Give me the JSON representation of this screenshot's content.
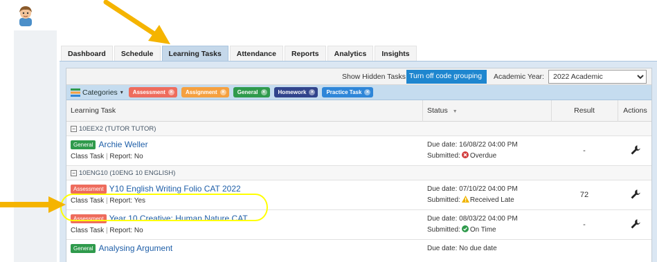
{
  "tabs": [
    "Dashboard",
    "Schedule",
    "Learning Tasks",
    "Attendance",
    "Reports",
    "Analytics",
    "Insights"
  ],
  "active_tab": "Learning Tasks",
  "toolbar": {
    "show_hidden_label": "Show Hidden Tasks",
    "code_grouping_button": "Turn off code grouping",
    "academic_year_label": "Academic Year:",
    "academic_year_value": "2022 Academic"
  },
  "categories": {
    "label": "Categories",
    "caret": "▾",
    "chips": [
      {
        "label": "Assessment",
        "color": "#ee6c5d"
      },
      {
        "label": "Assignment",
        "color": "#f5a03f"
      },
      {
        "label": "General",
        "color": "#2f9a4c"
      },
      {
        "label": "Homework",
        "color": "#31448c"
      },
      {
        "label": "Practice Task",
        "color": "#2f86d8"
      }
    ]
  },
  "columns": {
    "task": "Learning Task",
    "status": "Status",
    "status_sort": "▼",
    "result": "Result",
    "actions": "Actions"
  },
  "groups": [
    {
      "expander": "−",
      "name": "10EEX2 (TUTOR TUTOR)",
      "tasks": [
        {
          "badge": "General",
          "badge_color": "#2f9a4c",
          "title": "Archie Weller",
          "class_task": "Class Task",
          "separator": "|",
          "report": "Report: No",
          "due": "Due date: 16/08/22 04:00 PM",
          "submitted_label": "Submitted:",
          "submitted_status": "Overdue",
          "status_icon": "x-circle-icon",
          "status_color": "#d23b3b",
          "result": "-"
        }
      ]
    },
    {
      "expander": "−",
      "name": "10ENG10 (10ENG 10 ENGLISH)",
      "tasks": [
        {
          "badge": "Assessment",
          "badge_color": "#ee6c5d",
          "title": "Y10 English Writing Folio CAT 2022",
          "class_task": "Class Task",
          "separator": "|",
          "report": "Report: Yes",
          "due": "Due date: 07/10/22 04:00 PM",
          "submitted_label": "Submitted:",
          "submitted_status": "Received Late",
          "status_icon": "warning-icon",
          "status_color": "#f0b400",
          "result": "72"
        },
        {
          "badge": "Assessment",
          "badge_color": "#ee6c5d",
          "title": "Year 10 Creative: Human Nature CAT",
          "class_task": "Class Task",
          "separator": "|",
          "report": "Report: No",
          "due": "Due date: 08/03/22 04:00 PM",
          "submitted_label": "Submitted:",
          "submitted_status": "On Time",
          "status_icon": "check-circle-icon",
          "status_color": "#2f9a4c",
          "result": "-"
        },
        {
          "badge": "General",
          "badge_color": "#2f9a4c",
          "title": "Analysing Argument",
          "class_task": "",
          "separator": "",
          "report": "",
          "due": "Due date: No due date",
          "submitted_label": "",
          "submitted_status": "",
          "status_icon": "",
          "status_color": "#999999",
          "result": ""
        }
      ]
    }
  ],
  "annotation_colors": {
    "arrow": "#f5b400",
    "highlight": "#ffff00"
  }
}
